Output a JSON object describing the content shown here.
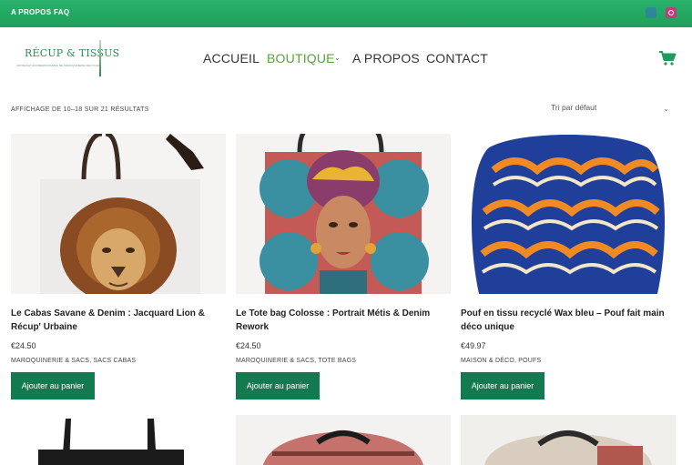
{
  "topbar": {
    "about": "A PROPOS",
    "faq": "FAQ"
  },
  "logo": {
    "name": "RÉCUP & TISSUS",
    "tagline": "ARTISANAT ÉCORESPONSABLE DE MAROQUINERIE RECYCLÉE"
  },
  "nav": {
    "accueil": "ACCUEIL",
    "boutique": "BOUTIQUE",
    "apropos": "A PROPOS",
    "contact": "CONTACT"
  },
  "toolbar": {
    "results": "AFFICHAGE DE 10–18 SUR 21 RÉSULTATS",
    "sort": "Tri par défaut"
  },
  "products": [
    {
      "title": "Le Cabas Savane & Denim : Jacquard Lion & Récup' Urbaine",
      "price": "€24.50",
      "categories": "MAROQUINERIE & SACS, SACS CABAS",
      "button": "Ajouter au panier"
    },
    {
      "title": "Le Tote bag Colosse : Portrait Métis & Denim Rework",
      "price": "€24.50",
      "categories": "MAROQUINERIE & SACS, TOTE BAGS",
      "button": "Ajouter au panier"
    },
    {
      "title": "Pouf en tissu recyclé Wax bleu – Pouf fait main déco unique",
      "price": "€49.97",
      "categories": "MAISON & DÉCO, POUFS",
      "button": "Ajouter au panier"
    }
  ],
  "colors": {
    "brand_green": "#1f9f5d",
    "button_green": "#137a4f",
    "nav_active": "#5aa33b"
  },
  "icons": [
    "facebook-icon",
    "instagram-icon",
    "cart-icon",
    "chevron-down-icon"
  ]
}
